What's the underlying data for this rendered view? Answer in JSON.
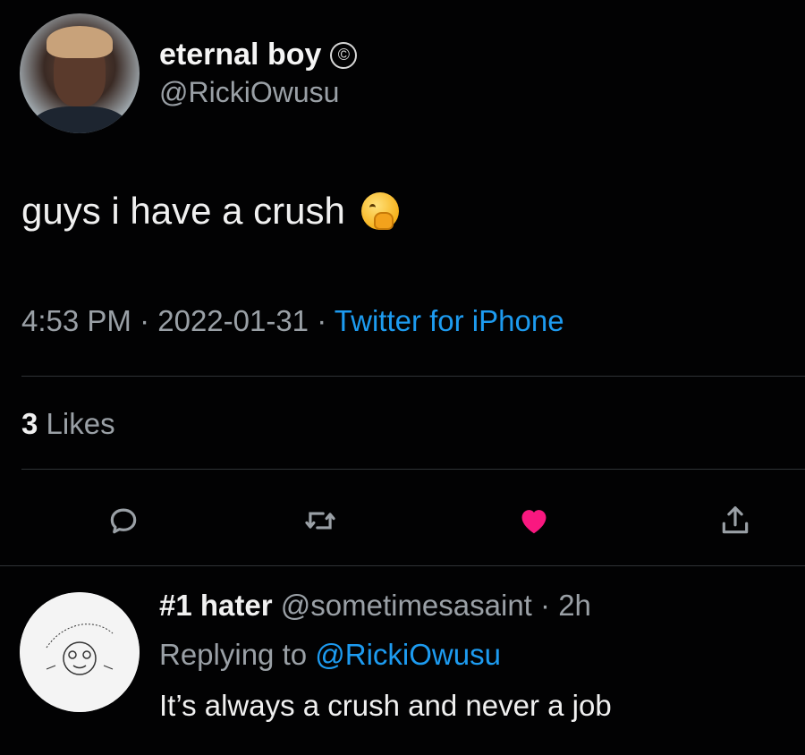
{
  "tweet": {
    "author": {
      "display_name": "eternal boy",
      "badge_icon": "copyright-icon",
      "badge_glyph": "©",
      "handle": "@RickiOwusu"
    },
    "text": "guys i have a crush",
    "emoji_icon": "hand-over-mouth-emoji-icon",
    "meta": {
      "time": "4:53 PM",
      "separator": " · ",
      "date": "2022-01-31",
      "source": "Twitter for iPhone"
    },
    "likes": {
      "count": "3",
      "label": " Likes"
    },
    "actions": [
      {
        "name": "reply",
        "icon": "speech-bubble-icon"
      },
      {
        "name": "retweet",
        "icon": "retweet-icon"
      },
      {
        "name": "like",
        "icon": "heart-icon",
        "active": true,
        "color": "#f91880"
      },
      {
        "name": "share",
        "icon": "share-icon"
      }
    ]
  },
  "reply": {
    "display_name": "#1 hater",
    "handle": "@sometimesasaint",
    "separator": " · ",
    "age": "2h",
    "replying_prefix": "Replying to ",
    "replying_to": "@RickiOwusu",
    "text": "It’s always a crush and never a job"
  },
  "colors": {
    "background": "#020203",
    "primary_text": "#f0f0f0",
    "secondary_text": "#9aa0a6",
    "link": "#1d9bf0",
    "like_active": "#f91880",
    "divider": "#2f3336"
  }
}
